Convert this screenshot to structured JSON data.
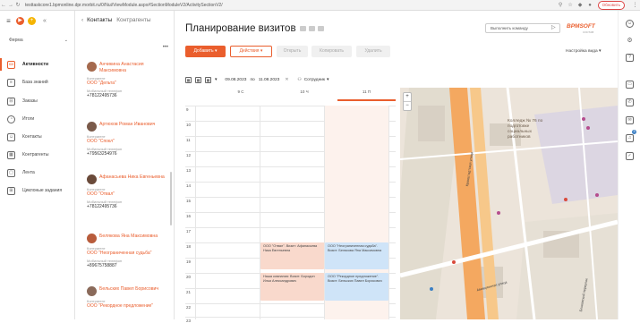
{
  "browser": {
    "url": "testtaskcore1.bpmonline.dpr.morbit.ru/0/Nui/ViewModule.aspx#SectionModuleV2/ActivitySectionV2/",
    "update_label": "Обновить"
  },
  "left_nav": {
    "workspace": "Фирма",
    "items": [
      {
        "label": "Активности",
        "icon": "activities-icon"
      },
      {
        "label": "База знаний",
        "icon": "knowledge-base-icon"
      },
      {
        "label": "Заказы",
        "icon": "orders-icon"
      },
      {
        "label": "Итоги",
        "icon": "dashboards-icon"
      },
      {
        "label": "Контакты",
        "icon": "contacts-icon"
      },
      {
        "label": "Контрагенты",
        "icon": "accounts-icon"
      },
      {
        "label": "Лента",
        "icon": "feed-icon"
      },
      {
        "label": "Циклоные задания",
        "icon": "cycle-tasks-icon"
      }
    ]
  },
  "contacts_panel": {
    "tabs": [
      "Контакты",
      "Контрагенты"
    ],
    "contacts": [
      {
        "name": "Анчикина Анастасия Максимовна",
        "account_label": "Контрагент",
        "account": "ООО \"Дельта\"",
        "phone_label": "Мобильный телефон",
        "phone": "+78122495736"
      },
      {
        "name": "Артюхов Роман Иванович",
        "account_label": "Контрагент",
        "account": "ООО \"Спокл\"",
        "phone_label": "Мобильный телефон",
        "phone": "+79563254976"
      },
      {
        "name": "Афанасьева Ника Евгеньевна",
        "account_label": "Контрагент",
        "account": "ООО \"Отвал\"",
        "phone_label": "Мобильный телефон",
        "phone": "+78122495736"
      },
      {
        "name": "Белякова Яна Максимовна",
        "account_label": "Контрагент",
        "account": "ООО \"Неограниченная судьба\"",
        "phone_label": "Мобильный телефон",
        "phone": "+89675758887"
      },
      {
        "name": "Бельских Павел Борисович",
        "account_label": "Контрагент",
        "account": "ООО \"Рекордное предложение\""
      }
    ]
  },
  "main": {
    "title": "Планирование визитов",
    "command_placeholder": "Выполнить команду",
    "brand": "BPMSOFT",
    "brand_sub": "СОСТАВ",
    "buttons": {
      "add": "Добавить",
      "actions": "Действия",
      "open": "Открыть",
      "copy": "Копировать",
      "delete": "Удалить"
    },
    "view_settings": "Настройка вида",
    "filter": {
      "date_from": "09.08.2023",
      "date_sep": "по",
      "date_to": "11.08.2023",
      "owner_label": "Сотрудник"
    }
  },
  "calendar": {
    "days": [
      "9 С",
      "10 Ч",
      "11 П"
    ],
    "hours": [
      "9",
      "10",
      "11",
      "12",
      "13",
      "14",
      "15",
      "16",
      "17",
      "18",
      "19",
      "20",
      "21",
      "22",
      "23"
    ],
    "events": [
      {
        "text": "ООО \"Отвал\". Визит: Афанасьева Ника Евгеньевна",
        "color": "orange"
      },
      {
        "text": "ООО \"Неограниченная судьба\". Визит: Белякова Яна Максимовна",
        "color": "blue"
      },
      {
        "text": "Наша компания: Визит: Бородин Илья Александрович",
        "color": "orange"
      },
      {
        "text": "ООО \"Рекордное предложение\". Визит: Бельских Павел Борисович",
        "color": "blue"
      }
    ]
  },
  "map": {
    "label": "Колледж № 76 по подготовке социальных работников",
    "streets": [
      "Кронштадтская улица",
      "Авиационная улица",
      "Блоковский переулок"
    ]
  },
  "colors": {
    "accent": "#ea5e2d",
    "event_orange": "#f9d9cc",
    "event_blue": "#cfe4f8"
  }
}
